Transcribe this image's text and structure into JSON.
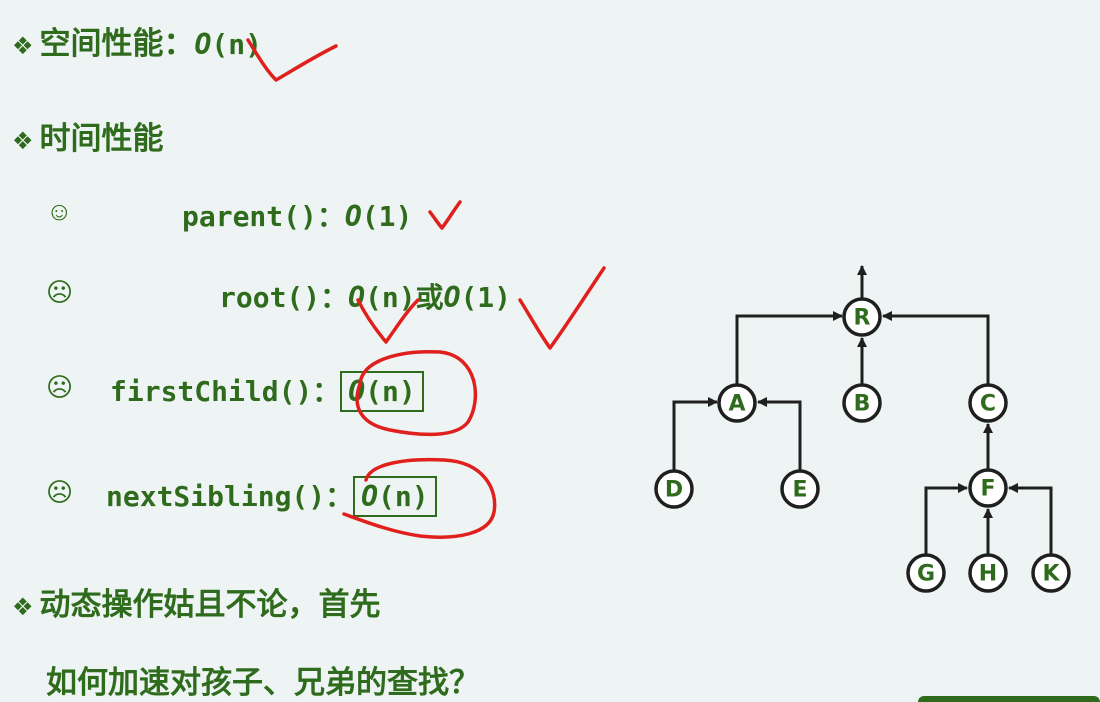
{
  "bullet_glyph": "❖",
  "space": {
    "label": "空间性能：",
    "complexity": "O",
    "arg": "(n)"
  },
  "time": {
    "label": "时间性能"
  },
  "ops": [
    {
      "face": "☺",
      "name": "parent()：",
      "o": "O",
      "rest": "(1)"
    },
    {
      "face": "☹",
      "name": "root()：",
      "o": "O",
      "rest": "(n)或",
      "o2": "O",
      "rest2": "(1)"
    },
    {
      "face": "☹",
      "name": "firstChild()：",
      "o": "O",
      "rest": "(n)"
    },
    {
      "face": "☹",
      "name": "nextSibling()：",
      "o": "O",
      "rest": "(n)"
    }
  ],
  "dynamic": {
    "line1": "动态操作姑且不论，首先",
    "line2": "如何加速对孩子、兄弟的查找？"
  },
  "tree": {
    "nodes": [
      "R",
      "A",
      "B",
      "C",
      "D",
      "E",
      "F",
      "G",
      "H",
      "K"
    ]
  },
  "colors": {
    "text": "#2f6b1c",
    "ink": "#e0201c",
    "background": "#eef4f3"
  }
}
